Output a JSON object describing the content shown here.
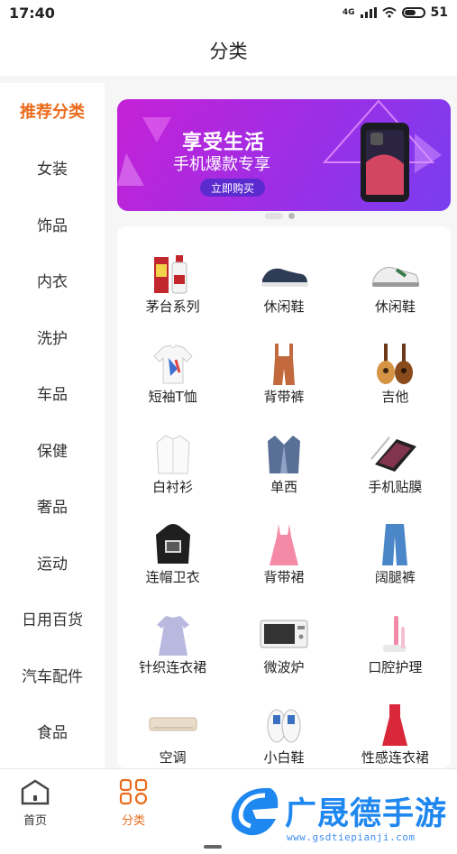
{
  "status_bar": {
    "time": "17:40",
    "network": "4G",
    "battery": "51"
  },
  "header": {
    "title": "分类"
  },
  "sidebar": {
    "items": [
      {
        "label": "推荐分类",
        "active": true
      },
      {
        "label": "女装"
      },
      {
        "label": "饰品"
      },
      {
        "label": "内衣"
      },
      {
        "label": "洗护"
      },
      {
        "label": "车品"
      },
      {
        "label": "保健"
      },
      {
        "label": "奢品"
      },
      {
        "label": "运动"
      },
      {
        "label": "日用百货"
      },
      {
        "label": "汽车配件"
      },
      {
        "label": "食品"
      }
    ]
  },
  "banner": {
    "title": "享受生活",
    "subtitle": "手机爆款专享",
    "button": "立即购买"
  },
  "products": [
    {
      "label": "茅台系列",
      "icon": "liquor-icon"
    },
    {
      "label": "休闲鞋",
      "icon": "dark-sneaker-icon"
    },
    {
      "label": "休闲鞋",
      "icon": "white-sneaker-icon"
    },
    {
      "label": "短袖T恤",
      "icon": "tshirt-icon"
    },
    {
      "label": "背带裤",
      "icon": "overalls-icon"
    },
    {
      "label": "吉他",
      "icon": "guitar-icon"
    },
    {
      "label": "白衬衫",
      "icon": "shirt-icon"
    },
    {
      "label": "单西",
      "icon": "blazer-icon"
    },
    {
      "label": "手机贴膜",
      "icon": "screen-protector-icon"
    },
    {
      "label": "连帽卫衣",
      "icon": "hoodie-icon"
    },
    {
      "label": "背带裙",
      "icon": "dress-icon"
    },
    {
      "label": "阔腿裤",
      "icon": "pants-icon"
    },
    {
      "label": "针织连衣裙",
      "icon": "knit-dress-icon"
    },
    {
      "label": "微波炉",
      "icon": "microwave-icon"
    },
    {
      "label": "口腔护理",
      "icon": "toothbrush-icon"
    },
    {
      "label": "空调",
      "icon": "air-conditioner-icon"
    },
    {
      "label": "小白鞋",
      "icon": "white-shoes-icon"
    },
    {
      "label": "性感连衣裙",
      "icon": "red-dress-icon"
    }
  ],
  "tabs": [
    {
      "label": "首页",
      "icon": "home-icon"
    },
    {
      "label": "分类",
      "icon": "category-icon",
      "active": true
    }
  ],
  "watermark": {
    "text": "广晟德手游",
    "url": "www.gsdtiepianji.com"
  },
  "colors": {
    "accent": "#ea6b1c",
    "banner_start": "#c521d6",
    "banner_end": "#7a3ef0",
    "watermark": "#1f87f0"
  }
}
